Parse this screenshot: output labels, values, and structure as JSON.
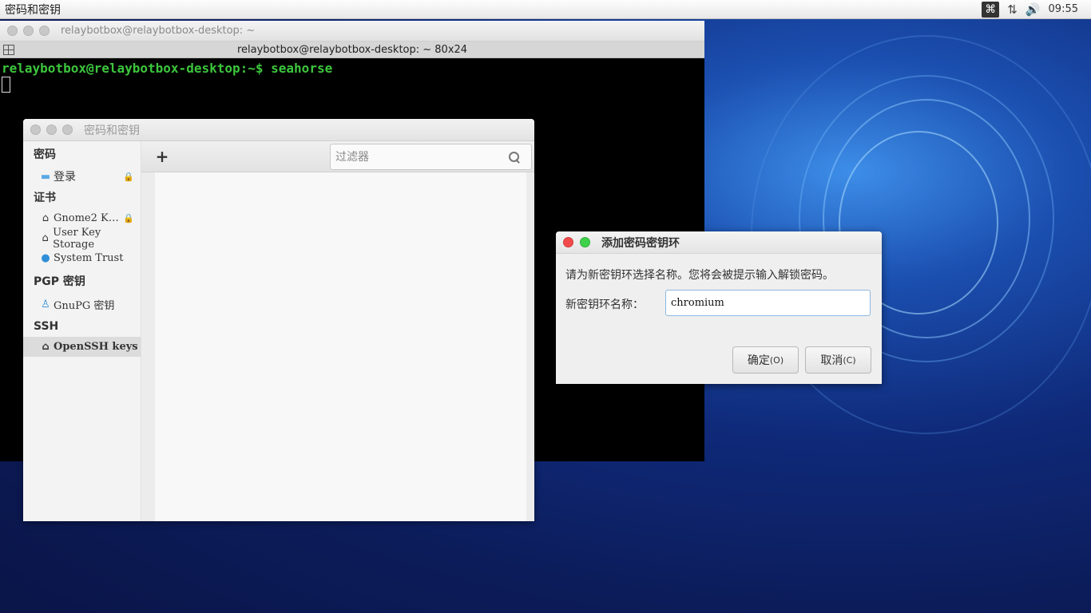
{
  "top_panel": {
    "app_title": "密码和密钥",
    "time": "09:55",
    "icons": [
      "command-icon",
      "network-icon",
      "volume-icon",
      "apple-icon"
    ]
  },
  "terminal": {
    "window_title": "relaybotbox@relaybotbox-desktop: ~",
    "tab_label": "relaybotbox@relaybotbox-desktop: ~ 80x24",
    "prompt": "relaybotbox@relaybotbox-desktop:~$ seahorse"
  },
  "seahorse": {
    "window_title": "密码和密钥",
    "filter_placeholder": "过滤器",
    "sidebar": {
      "passwords_header": "密码",
      "login": "登录",
      "certificates_header": "证书",
      "gnome2": "Gnome2 K…",
      "user_key_storage": "User Key Storage",
      "system_trust": "System Trust",
      "pgp_header": "PGP 密钥",
      "gnupg": "GnuPG 密钥",
      "ssh_header": "SSH",
      "openssh": "OpenSSH keys"
    }
  },
  "dialog": {
    "title": "添加密码密钥环",
    "message": "请为新密钥环选择名称。您将会被提示输入解锁密码。",
    "name_label": "新密钥环名称：",
    "name_value": "chromium",
    "ok_label": "确定",
    "ok_mnemonic": "(O)",
    "cancel_label": "取消",
    "cancel_mnemonic": "(C)"
  }
}
